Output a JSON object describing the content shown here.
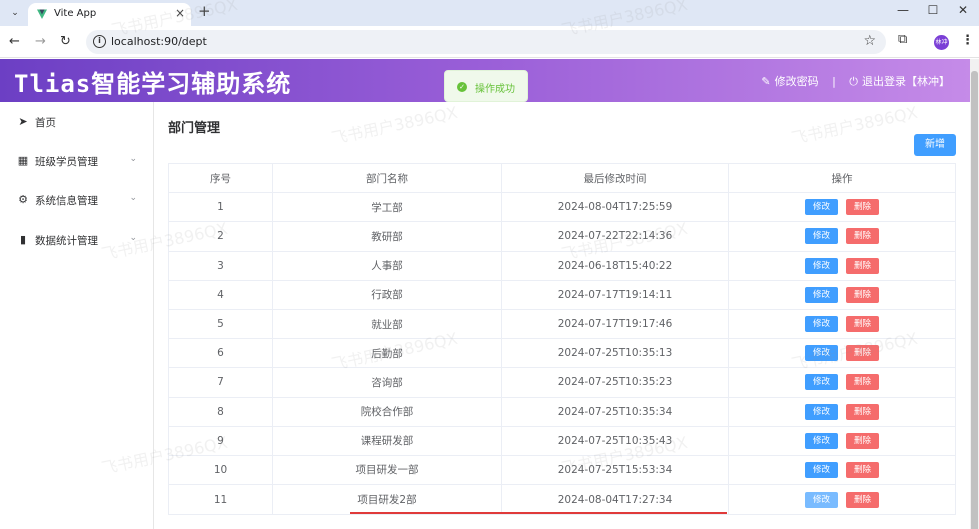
{
  "browser": {
    "tab_title": "Vite App",
    "tab_close": "×",
    "new_tab": "+",
    "url": "localhost:90/dept",
    "profile_initials": "林冲",
    "icons": [
      "tab-menu-icon",
      "vite-favicon",
      "back-icon",
      "forward-icon",
      "reload-icon",
      "site-info-icon",
      "bookmark-star-icon",
      "extensions-icon",
      "more-icon",
      "minimize-icon",
      "maximize-icon",
      "close-window-icon"
    ]
  },
  "header": {
    "brand": "Tlias智能学习辅助系统",
    "change_password": "修改密码",
    "separator": "|",
    "logout": "退出登录【林冲】",
    "gradient_start": "#6c3fc4",
    "gradient_end": "#c58be8"
  },
  "toast": {
    "text": "操作成功",
    "color": "#67c23a"
  },
  "sidebar": {
    "items": [
      {
        "label": "首页",
        "icon": "send-icon"
      },
      {
        "label": "班级学员管理",
        "icon": "grid-icon"
      },
      {
        "label": "系统信息管理",
        "icon": "gear-icon"
      },
      {
        "label": "数据统计管理",
        "icon": "bar-chart-icon"
      }
    ]
  },
  "main": {
    "title": "部门管理",
    "add_button": "新增",
    "columns": [
      "序号",
      "部门名称",
      "最后修改时间",
      "操作"
    ],
    "edit_label": "修改",
    "delete_label": "删除",
    "rows": [
      {
        "no": "1",
        "name": "学工部",
        "time": "2024-08-04T17:25:59"
      },
      {
        "no": "2",
        "name": "教研部",
        "time": "2024-07-22T22:14:36"
      },
      {
        "no": "3",
        "name": "人事部",
        "time": "2024-06-18T15:40:22"
      },
      {
        "no": "4",
        "name": "行政部",
        "time": "2024-07-17T19:14:11"
      },
      {
        "no": "5",
        "name": "就业部",
        "time": "2024-07-17T19:17:46"
      },
      {
        "no": "6",
        "name": "后勤部",
        "time": "2024-07-25T10:35:13"
      },
      {
        "no": "7",
        "name": "咨询部",
        "time": "2024-07-25T10:35:23"
      },
      {
        "no": "8",
        "name": "院校合作部",
        "time": "2024-07-25T10:35:34"
      },
      {
        "no": "9",
        "name": "课程研发部",
        "time": "2024-07-25T10:35:43"
      },
      {
        "no": "10",
        "name": "项目研发一部",
        "time": "2024-07-25T15:53:34"
      },
      {
        "no": "11",
        "name": "项目研发2部",
        "time": "2024-08-04T17:27:34"
      }
    ],
    "primary_color": "#409eff",
    "danger_color": "#f56c6c"
  },
  "watermark": "飞书用户3896QX"
}
